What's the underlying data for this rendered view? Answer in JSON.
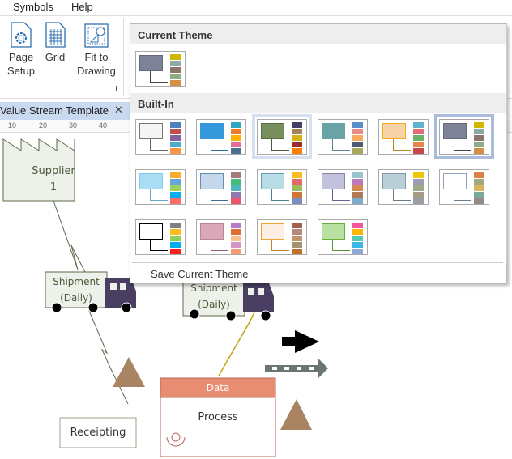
{
  "menu": {
    "items": [
      "Symbols",
      "Help"
    ]
  },
  "ribbon": {
    "page_setup": [
      "Page",
      "Setup"
    ],
    "grid": "Grid",
    "fit": [
      "Fit to",
      "Drawing"
    ]
  },
  "tab": {
    "title": "Value Stream Template",
    "close": "✕"
  },
  "ruler": {
    "ticks": [
      "10",
      "20",
      "30",
      "40"
    ]
  },
  "theme_panel": {
    "current_title": "Current Theme",
    "builtin_title": "Built-In",
    "save_label": "Save Current Theme",
    "current": {
      "fill": "#7e8296",
      "border": "#666a7e",
      "line": "#444",
      "swatches": [
        "#d1b600",
        "#8ea8a6",
        "#8a7769",
        "#8fac87",
        "#d48f46"
      ]
    },
    "themes": [
      {
        "fill": "#f4f4f4",
        "border": "#777777",
        "line": "#666",
        "swatches": [
          "#4f81bd",
          "#c0504d",
          "#8064a2",
          "#4bacc6",
          "#f79646"
        ]
      },
      {
        "fill": "#3498db",
        "border": "#3498db",
        "line": "#2d6a9a",
        "swatches": [
          "#2ea6c0",
          "#ef7b31",
          "#ffb300",
          "#e06f9a",
          "#4e6e91"
        ]
      },
      {
        "fill": "#778f5c",
        "border": "#5a6e45",
        "line": "#4a5a3a",
        "swatches": [
          "#463f64",
          "#a58361",
          "#d8b316",
          "#9b2b2f",
          "#ff8000"
        ],
        "state": "hover"
      },
      {
        "fill": "#68a3a8",
        "border": "#68a3a8",
        "line": "#5a8a90",
        "swatches": [
          "#5a8fcd",
          "#ea8a84",
          "#f6a85f",
          "#4f5b70",
          "#a6a95c"
        ]
      },
      {
        "fill": "#f7d3aa",
        "border": "#f4ab19",
        "line": "#b08a20",
        "swatches": [
          "#5fb3cf",
          "#e86a79",
          "#6bb36b",
          "#e8844e",
          "#c9474c"
        ]
      },
      {
        "fill": "#7e8296",
        "border": "#666a7e",
        "line": "#444",
        "swatches": [
          "#d1b600",
          "#8ea8a6",
          "#8a7769",
          "#8fac87",
          "#d48f46"
        ],
        "state": "selected"
      },
      {
        "fill": "#aadcf3",
        "border": "#7bcdf0",
        "line": "#6aaac0",
        "swatches": [
          "#fbab30",
          "#68a6d8",
          "#98d262",
          "#00adef",
          "#ff6b6b"
        ]
      },
      {
        "fill": "#c5d8ea",
        "border": "#5f8fb7",
        "line": "#3d6d94",
        "swatches": [
          "#a37d7a",
          "#44bd7a",
          "#4fb5c0",
          "#8f78ab",
          "#e9556b"
        ]
      },
      {
        "fill": "#b9dbe4",
        "border": "#5fa1b0",
        "line": "#4a8090",
        "swatches": [
          "#fbbc1f",
          "#e46a68",
          "#9dbb5a",
          "#d27534",
          "#7a8ebf"
        ]
      },
      {
        "fill": "#c2c2dc",
        "border": "#8a83a5",
        "line": "#6a6290",
        "swatches": [
          "#99c6cc",
          "#bb7ac0",
          "#d58955",
          "#b47855",
          "#7fa9c9"
        ]
      },
      {
        "fill": "#b9ced6",
        "border": "#7e9ca6",
        "line": "#6a8088",
        "swatches": [
          "#eec800",
          "#a19cb3",
          "#9eaa85",
          "#a79b83",
          "#9a9ea5"
        ]
      },
      {
        "fill": "#ffffff",
        "border": "#8ca4c0",
        "line": "#6a8090",
        "swatches": [
          "#dd7f4a",
          "#a5a87a",
          "#d9b55e",
          "#7aa89e",
          "#968a86"
        ]
      },
      {
        "fill": "#ffffff",
        "border": "#000000",
        "line": "#000",
        "swatches": [
          "#808080",
          "#fbbc1f",
          "#8bd057",
          "#00adef",
          "#ff1c1c"
        ]
      },
      {
        "fill": "#d9a8b7",
        "border": "#b98496",
        "line": "#9a6070",
        "swatches": [
          "#b77ac6",
          "#e06c35",
          "#f8c28e",
          "#d196c4",
          "#f89a72"
        ]
      },
      {
        "fill": "#fdeee4",
        "border": "#f2a431",
        "line": "#c08030",
        "swatches": [
          "#a2614a",
          "#b58a7c",
          "#c19467",
          "#a39470",
          "#c07128"
        ]
      },
      {
        "fill": "#b8e0a0",
        "border": "#6ab038",
        "line": "#5a9030",
        "swatches": [
          "#f2569f",
          "#ffb400",
          "#53c8b4",
          "#3bb8e4",
          "#8fa7d3"
        ]
      }
    ]
  },
  "diagram": {
    "supplier": [
      "Supplier",
      "1"
    ],
    "shipment1": [
      "Shipment",
      "(Daily)"
    ],
    "shipment2": [
      "Shipment",
      "(Daily)"
    ],
    "data_label": "Data",
    "process_label": "Process",
    "receipting": "Receipting",
    "colors": {
      "truck": "#4a3f62",
      "triangle": "#a88462",
      "data_header": "#e88c72",
      "process_border": "#b86a5a"
    }
  }
}
